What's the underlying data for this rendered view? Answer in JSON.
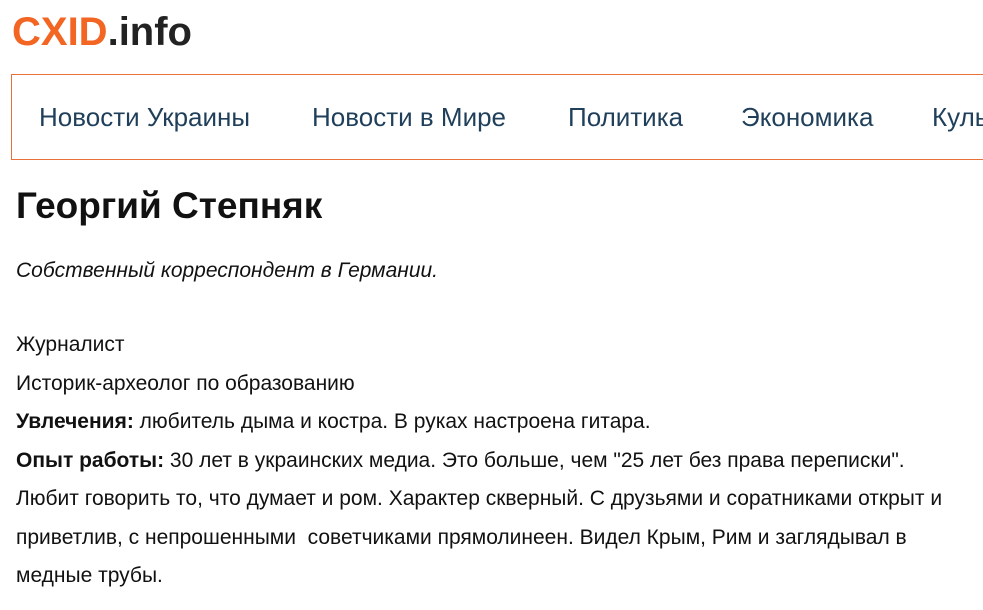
{
  "logo": {
    "brand": "CXID",
    "tld": ".info"
  },
  "nav": {
    "items": [
      {
        "label": "Новости Украины"
      },
      {
        "label": "Новости в Мире"
      },
      {
        "label": "Политика"
      },
      {
        "label": "Экономика"
      },
      {
        "label": "Культура"
      }
    ]
  },
  "author": {
    "name": "Георгий Степняк",
    "subtitle": "Собственный корреспондент в Германии.",
    "profession": "Журналист",
    "education": "Историк-археолог по образованию",
    "hobbies_label": "Увлечения:",
    "hobbies_text": " любитель дыма и костра. В руках настроена гитара.",
    "experience_label": "Опыт работы:",
    "experience_text": " 30 лет в украинских медиа. Это больше, чем \"25 лет без права переписки\".",
    "about": "Любит говорить то, что думает и ром. Характер скверный. С друзьями и соратниками открыт и приветлив, с непрошенными  советчиками прямолинеен. Видел Крым, Рим и заглядывал в медные трубы."
  },
  "colors": {
    "brand_orange": "#f26522",
    "nav_border": "#e8703a",
    "nav_text": "#1f3f5a"
  }
}
